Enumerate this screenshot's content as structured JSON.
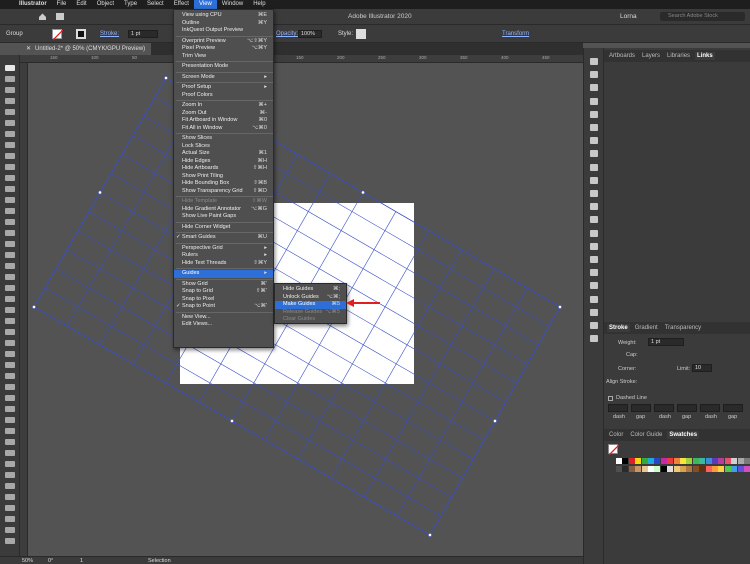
{
  "menubar": {
    "items": [
      {
        "label": "",
        "id": "apple"
      },
      {
        "label": "Illustrator"
      },
      {
        "label": "File"
      },
      {
        "label": "Edit"
      },
      {
        "label": "Object"
      },
      {
        "label": "Type"
      },
      {
        "label": "Select"
      },
      {
        "label": "Effect"
      },
      {
        "label": "View"
      },
      {
        "label": "Window"
      },
      {
        "label": "Help"
      }
    ]
  },
  "appbar": {
    "title": "Adobe Illustrator 2020",
    "user": "Lorna",
    "search_placeholder": "Search Adobe Stock"
  },
  "control": {
    "selection": "Group",
    "stroke_label": "Stroke:",
    "stroke_value": "1 pt",
    "opacity_label": "Opacity:",
    "opacity_value": "100%",
    "style_label": "Style:",
    "transform_label": "Transform"
  },
  "document": {
    "tab": "Untitled-2* @ 50% (CMYK/GPU Preview)",
    "ruler_marks": [
      "150",
      "100",
      "50",
      "0",
      "50",
      "100",
      "150",
      "200",
      "250",
      "300",
      "350",
      "400",
      "450",
      "500"
    ]
  },
  "status": {
    "zoom": "50%",
    "rotation": "0°",
    "artboard": "1",
    "tool": "Selection"
  },
  "view_menu": {
    "items": [
      {
        "label": "View using CPU",
        "key": "⌘E"
      },
      {
        "label": "Outline",
        "key": "⌘Y"
      },
      {
        "label": "InkQuest Output Preview",
        "key": ""
      },
      {
        "sep": true
      },
      {
        "label": "Overprint Preview",
        "key": "⌥⇧⌘Y"
      },
      {
        "label": "Pixel Preview",
        "key": "⌥⌘Y"
      },
      {
        "label": "Trim View",
        "key": ""
      },
      {
        "sep": true
      },
      {
        "label": "Presentation Mode",
        "key": ""
      },
      {
        "sep": true
      },
      {
        "label": "Screen Mode",
        "key": "▸"
      },
      {
        "sep": true
      },
      {
        "label": "Proof Setup",
        "key": "▸"
      },
      {
        "label": "Proof Colors",
        "key": ""
      },
      {
        "sep": true
      },
      {
        "label": "Zoom In",
        "key": "⌘+"
      },
      {
        "label": "Zoom Out",
        "key": "⌘-"
      },
      {
        "label": "Fit Artboard in Window",
        "key": "⌘0"
      },
      {
        "label": "Fit All in Window",
        "key": "⌥⌘0"
      },
      {
        "sep": true
      },
      {
        "label": "Show Slices",
        "key": ""
      },
      {
        "label": "Lock Slices",
        "key": ""
      },
      {
        "label": "Actual Size",
        "key": "⌘1"
      },
      {
        "label": "Hide Edges",
        "key": "⌘H"
      },
      {
        "label": "Hide Artboards",
        "key": "⇧⌘H"
      },
      {
        "label": "Show Print Tiling",
        "key": ""
      },
      {
        "label": "Hide Bounding Box",
        "key": "⇧⌘B"
      },
      {
        "label": "Show Transparency Grid",
        "key": "⇧⌘D"
      },
      {
        "sep": true
      },
      {
        "label": "Hide Template",
        "key": "⇧⌘W",
        "disabled": true
      },
      {
        "label": "Hide Gradient Annotator",
        "key": "⌥⌘G"
      },
      {
        "label": "Show Live Paint Gaps",
        "key": ""
      },
      {
        "sep": true
      },
      {
        "label": "Hide Corner Widget",
        "key": ""
      },
      {
        "sep": true
      },
      {
        "label": "Smart Guides",
        "key": "⌘U",
        "check": true
      },
      {
        "sep": true
      },
      {
        "label": "Perspective Grid",
        "key": "▸"
      },
      {
        "label": "Rulers",
        "key": "▸"
      },
      {
        "label": "Hide Text Threads",
        "key": "⇧⌘Y"
      },
      {
        "sep": true
      },
      {
        "label": "Guides",
        "key": "▸",
        "highlight": true
      },
      {
        "sep": true
      },
      {
        "label": "Show Grid",
        "key": "⌘'"
      },
      {
        "label": "Snap to Grid",
        "key": "⇧⌘'"
      },
      {
        "label": "Snap to Pixel",
        "key": ""
      },
      {
        "label": "Snap to Point",
        "key": "⌥⌘'",
        "check": true
      },
      {
        "sep": true
      },
      {
        "label": "New View...",
        "key": ""
      },
      {
        "label": "Edit Views...",
        "key": ""
      }
    ]
  },
  "guides_submenu": {
    "items": [
      {
        "label": "Hide Guides",
        "key": "⌘;"
      },
      {
        "label": "Unlock Guides",
        "key": "⌥⌘;"
      },
      {
        "label": "Make Guides",
        "key": "⌘5",
        "highlight": true
      },
      {
        "label": "Release Guides",
        "key": "⌥⌘5",
        "disabled": true
      },
      {
        "label": "Clear Guides",
        "key": "",
        "disabled": true
      }
    ]
  },
  "panels": {
    "top_tabs": [
      "Artboards",
      "Layers",
      "Libraries",
      "Links"
    ],
    "stroke_tabs": [
      "Stroke",
      "Gradient",
      "Transparency"
    ],
    "stroke": {
      "weight_label": "Weight:",
      "weight_value": "1 pt",
      "cap_label": "Cap:",
      "corner_label": "Corner:",
      "limit_label": "Limit:",
      "limit_value": "10",
      "align_label": "Align Stroke:",
      "dashed_label": "Dashed Line",
      "dash_labels": [
        "dash",
        "gap",
        "dash",
        "gap",
        "dash",
        "gap"
      ]
    },
    "color_tabs": [
      "Color",
      "Color Guide",
      "Swatches"
    ]
  },
  "colors": {
    "accent": "#2d6fd6",
    "grid_line": "#3a4fc7",
    "arrow": "#e02020"
  }
}
